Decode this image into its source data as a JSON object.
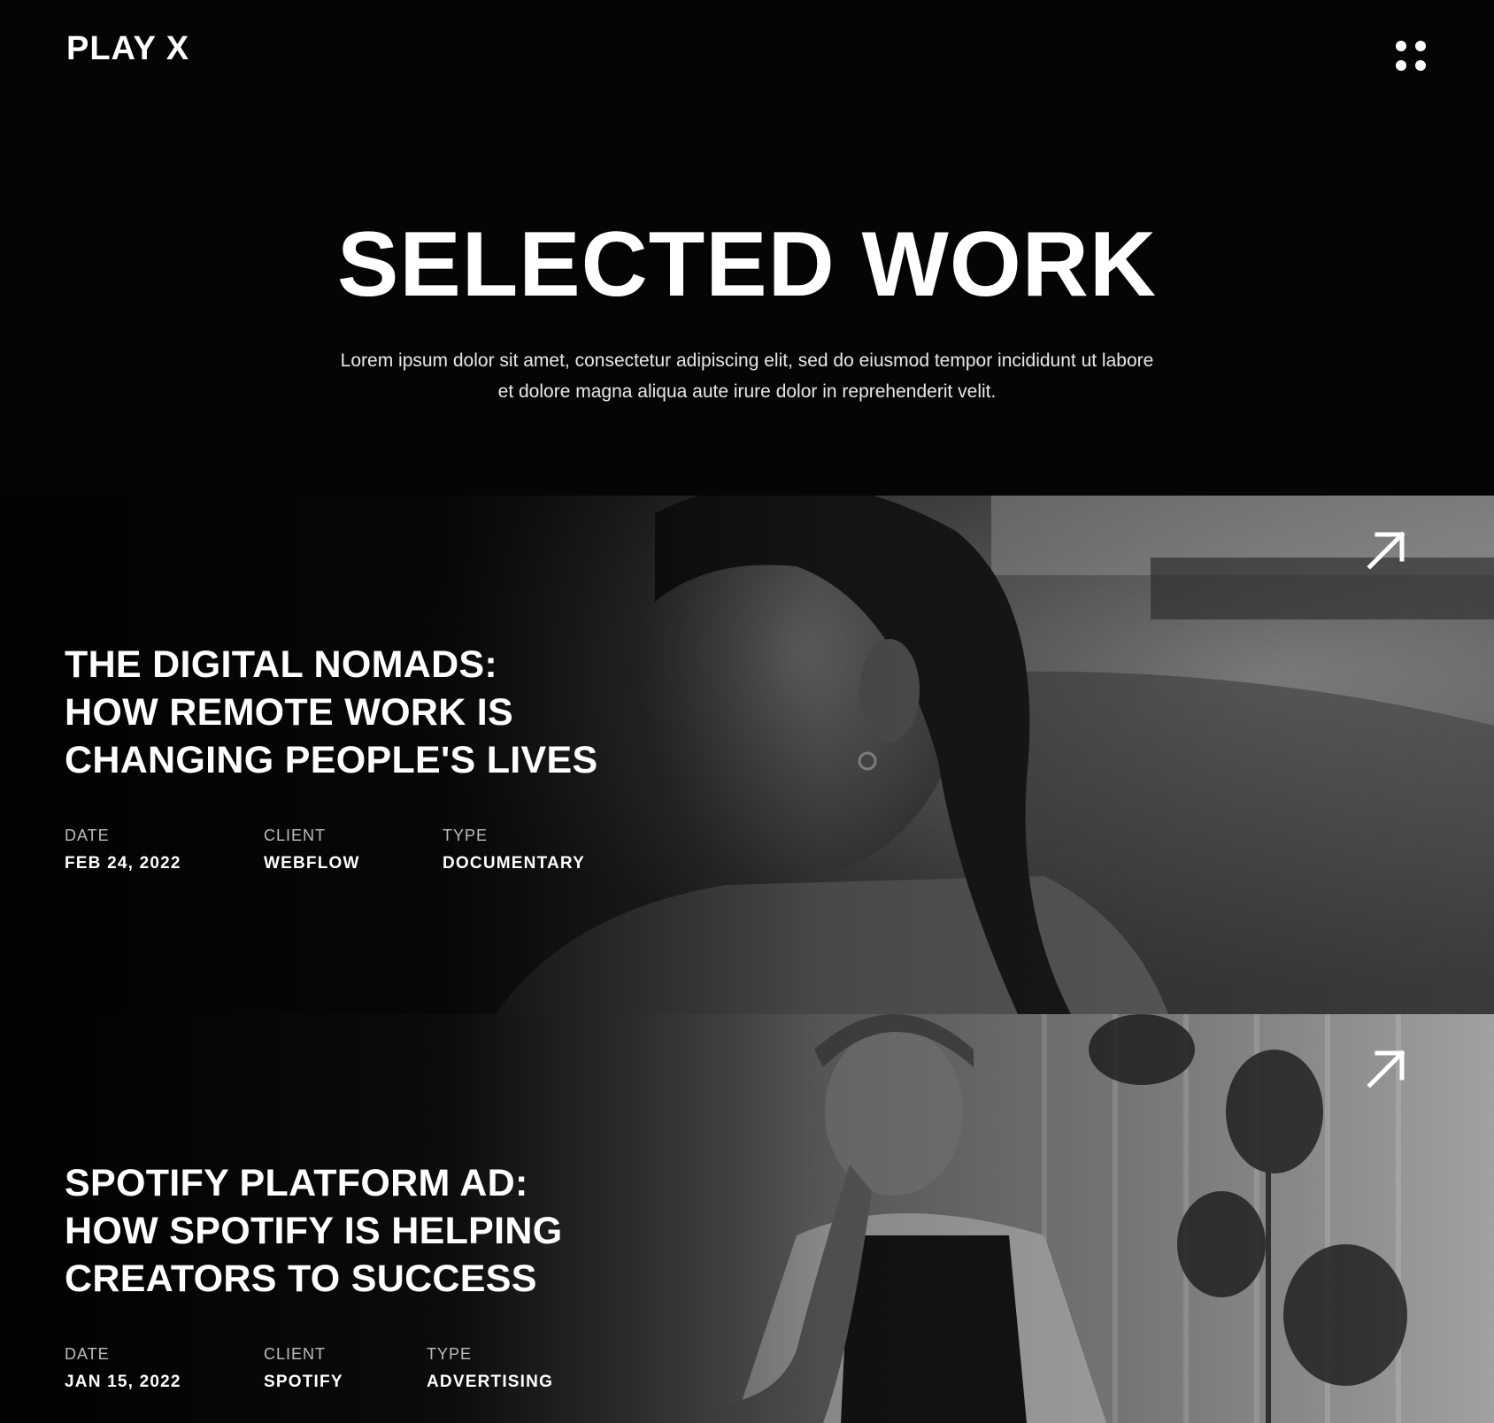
{
  "header": {
    "logo": "PLAY X",
    "menu_icon": "grid-dots-icon"
  },
  "hero": {
    "title": "SELECTED WORK",
    "subtitle": "Lorem ipsum dolor sit amet, consectetur adipiscing elit, sed do eiusmod tempor incididunt ut labore et dolore magna aliqua aute irure dolor in reprehenderit velit."
  },
  "projects": [
    {
      "title_lines": [
        "THE DIGITAL NOMADS:",
        "HOW REMOTE WORK IS",
        "CHANGING PEOPLE'S LIVES"
      ],
      "date_label": "DATE",
      "date": "FEB 24, 2022",
      "client_label": "CLIENT",
      "client": "WEBFLOW",
      "type_label": "TYPE",
      "type": "DOCUMENTARY",
      "image": "girl-portrait-photo",
      "link_icon": "arrow-up-right-icon"
    },
    {
      "title_lines": [
        "SPOTIFY PLATFORM AD:",
        "HOW SPOTIFY IS HELPING",
        "CREATORS TO SUCCESS"
      ],
      "date_label": "DATE",
      "date": "JAN 15, 2022",
      "client_label": "CLIENT",
      "client": "SPOTIFY",
      "type_label": "TYPE",
      "type": "ADVERTISING",
      "image": "girl-saxophone-photo",
      "link_icon": "arrow-up-right-icon"
    }
  ],
  "colors": {
    "background": "#050505",
    "text": "#ffffff",
    "muted": "#bdbdbd"
  }
}
